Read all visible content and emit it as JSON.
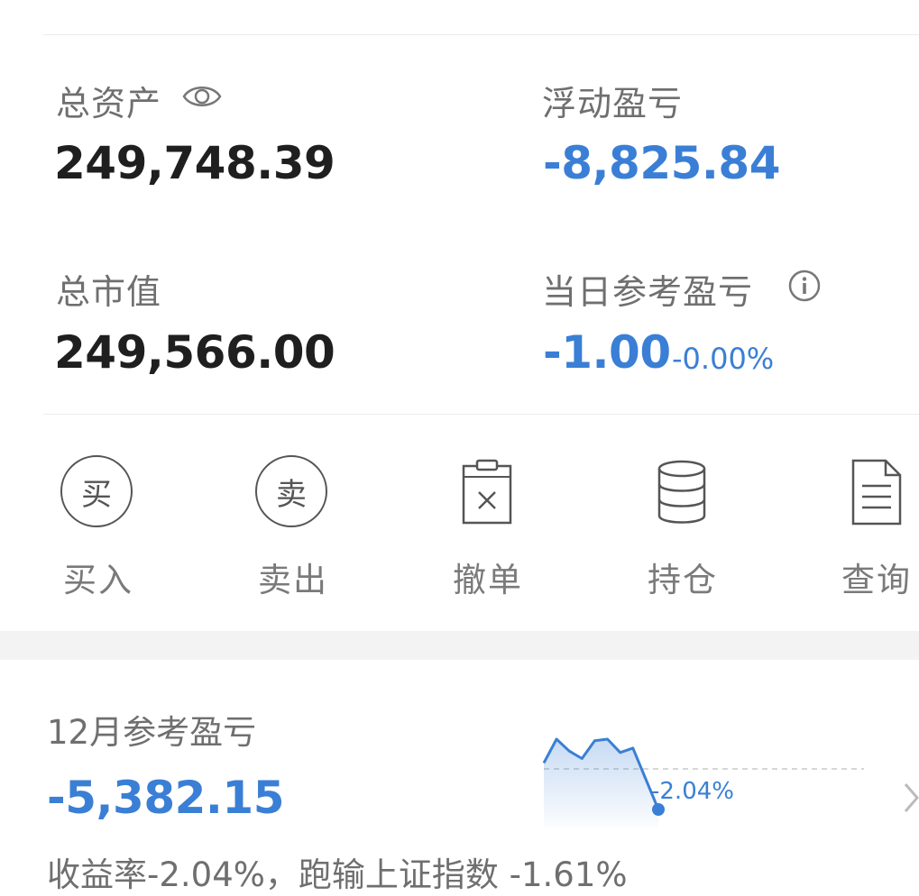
{
  "account": {
    "total_assets_label": "总资产",
    "total_assets_value": "249,748.39",
    "floating_pl_label": "浮动盈亏",
    "floating_pl_value": "-8,825.84",
    "market_value_label": "总市值",
    "market_value_value": "249,566.00",
    "daily_pl_label": "当日参考盈亏",
    "daily_pl_value": "-1.00",
    "daily_pl_pct": "-0.00%"
  },
  "actions": [
    {
      "label": "买入",
      "icon_text": "买",
      "icon": "buy-circle-icon"
    },
    {
      "label": "卖出",
      "icon_text": "卖",
      "icon": "sell-circle-icon"
    },
    {
      "label": "撤单",
      "icon": "cancel-order-clipboard-icon"
    },
    {
      "label": "持仓",
      "icon": "holdings-database-icon"
    },
    {
      "label": "查询",
      "icon": "query-document-icon"
    }
  ],
  "monthly": {
    "label": "12月参考盈亏",
    "value": "-5,382.15",
    "return_text": "收益率-2.04%，跑输上证指数 -1.61%",
    "sparkline_label": "-2.04%"
  },
  "chart_data": {
    "type": "area",
    "series": [
      {
        "values": [
          0.2,
          1.0,
          0.6,
          0.35,
          0.95,
          1.0,
          0.55,
          0.7,
          -0.5,
          -2.04
        ]
      }
    ],
    "baseline": 0,
    "annotation": "-2.04%"
  },
  "colors": {
    "accent_blue": "#3a7fd5",
    "text_dark": "#1f1f1f",
    "text_gray": "#6f6f6f"
  }
}
